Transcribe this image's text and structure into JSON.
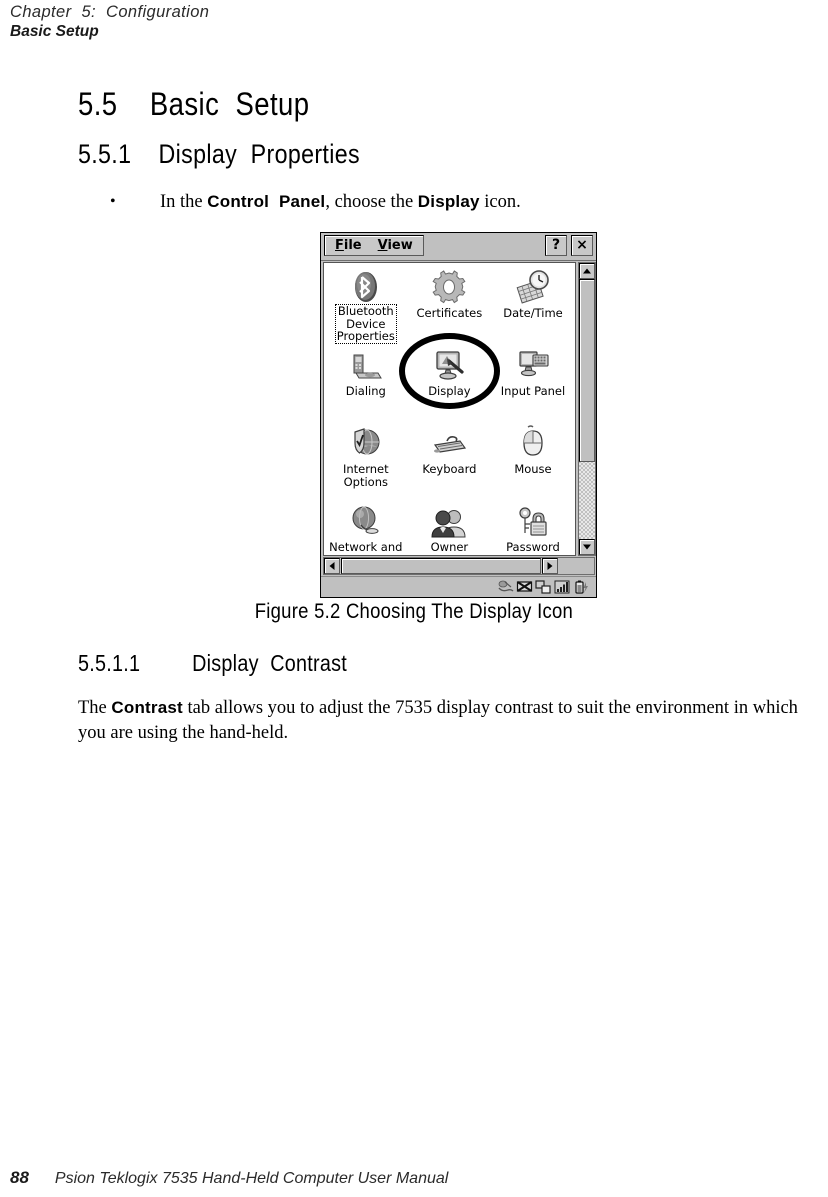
{
  "running_head": {
    "chapter": "Chapter  5:  Configuration",
    "section": "Basic Setup"
  },
  "headings": {
    "h1": "5.5    Basic  Setup",
    "h2": "5.5.1    Display  Properties",
    "h3": "5.5.1.1         Display  Contrast"
  },
  "bullet": {
    "marker": "•",
    "prefix": "In the ",
    "term1": "Control  Panel",
    "middle": ", choose the ",
    "term2": "Display",
    "suffix": " icon."
  },
  "figure": {
    "caption": "Figure  5.2  Choosing  The  Display  Icon"
  },
  "paragraph": {
    "prefix": "The ",
    "term": "Contrast",
    "rest": " tab allows you to adjust the 7535 display contrast to suit the environment in which you are using the hand-held."
  },
  "footer": {
    "page_number": "88",
    "manual_title": "Psion Teklogix 7535 Hand-Held Computer User Manual"
  },
  "control_panel": {
    "menus": [
      {
        "accel": "F",
        "rest": "ile"
      },
      {
        "accel": "V",
        "rest": "iew"
      }
    ],
    "help_button": "?",
    "close_button": "×",
    "icons": [
      {
        "label": "Bluetooth\nDevice\nProperties",
        "icon": "bluetooth-icon",
        "selected": true
      },
      {
        "label": "Certificates",
        "icon": "certificates-gear-icon",
        "selected": false
      },
      {
        "label": "Date/Time",
        "icon": "date-time-clock-icon",
        "selected": false
      },
      {
        "label": "Dialing",
        "icon": "dialing-phone-icon",
        "selected": false
      },
      {
        "label": "Display",
        "icon": "display-monitor-icon",
        "selected": false
      },
      {
        "label": "Input Panel",
        "icon": "input-panel-keyboard-icon",
        "selected": false
      },
      {
        "label": "Internet\nOptions",
        "icon": "internet-options-globe-icon",
        "selected": false
      },
      {
        "label": "Keyboard",
        "icon": "keyboard-icon",
        "selected": false
      },
      {
        "label": "Mouse",
        "icon": "mouse-icon",
        "selected": false
      },
      {
        "label": "Network and",
        "icon": "network-globe-icon",
        "selected": false
      },
      {
        "label": "Owner",
        "icon": "owner-people-icon",
        "selected": false
      },
      {
        "label": "Password",
        "icon": "password-key-lock-icon",
        "selected": false
      }
    ],
    "tray_icons": [
      "stylus-hand-icon",
      "network-disconnected-icon",
      "dual-display-icon",
      "signal-strength-icon",
      "battery-charging-icon"
    ]
  },
  "annotation": {
    "target": "Display",
    "shape": "ellipse"
  },
  "colors": {
    "window_face": "#c0c0c0",
    "client_background": "#ffffff",
    "text": "#000000",
    "annotation": "#000000"
  }
}
